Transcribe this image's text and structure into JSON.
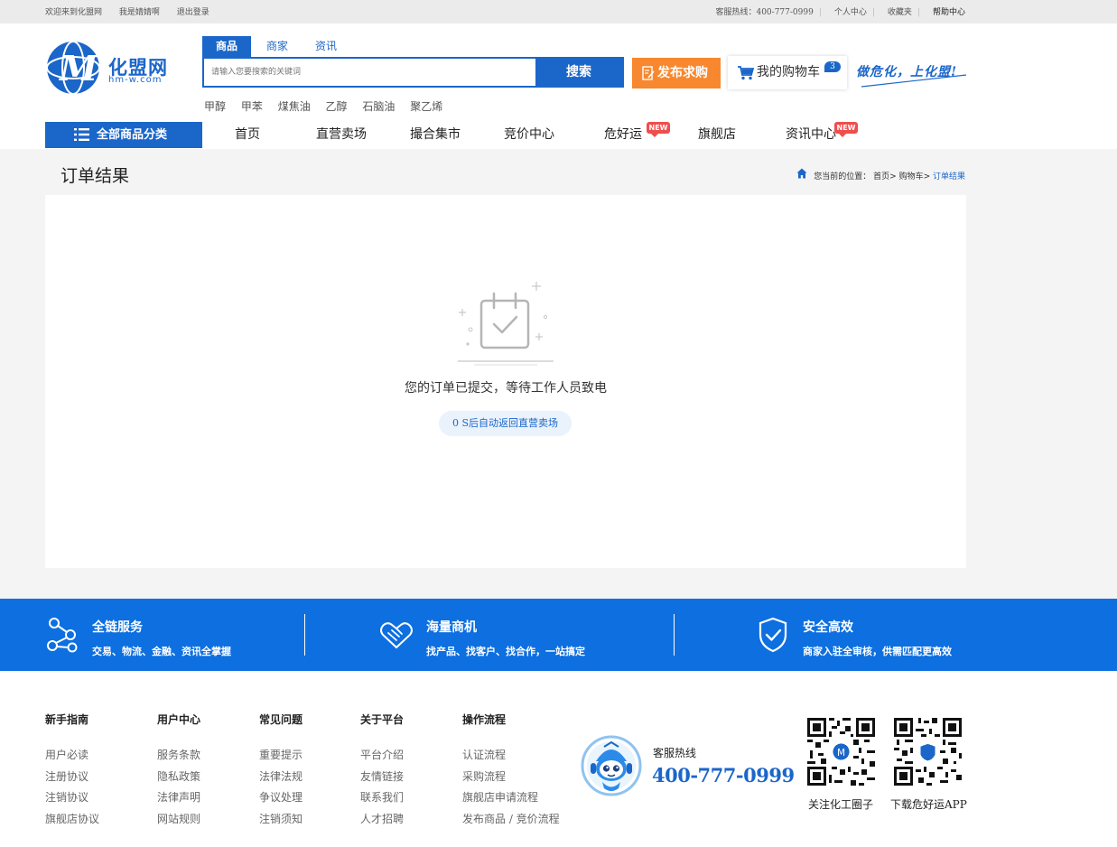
{
  "topbar": {
    "welcome": "欢迎来到化盟网",
    "username": "我是婧婧啊",
    "logout": "退出登录",
    "hotline_label": "客服热线：400-777-0999",
    "user_center": "个人中心",
    "favorites": "收藏夹",
    "help_center": "帮助中心"
  },
  "logo": {
    "name": "化盟网",
    "domain": "hm-w.com"
  },
  "search": {
    "tabs": [
      "商品",
      "商家",
      "资讯"
    ],
    "placeholder": "请输入您要搜索的关键词",
    "button": "搜索",
    "hotwords": [
      "甲醇",
      "甲苯",
      "煤焦油",
      "乙醇",
      "石脑油",
      "聚乙烯"
    ]
  },
  "header": {
    "publish_label": "发布求购",
    "cart_label": "我的购物车",
    "cart_count": "3",
    "slogan": "做危化，上化盟!"
  },
  "nav": {
    "all_categories": "全部商品分类",
    "items": [
      "首页",
      "直营卖场",
      "撮合集市",
      "竞价中心",
      "危好运",
      "旗舰店",
      "资讯中心"
    ],
    "new_badge": "NEW"
  },
  "page": {
    "title": "订单结果",
    "breadcrumb_prefix": "您当前的位置：",
    "crumb_home": "首页",
    "crumb_cart": "购物车",
    "crumb_current": "订单结果",
    "message": "您的订单已提交，等待工作人员致电",
    "return_link": "0 S后自动返回直营卖场"
  },
  "features": [
    {
      "title": "全链服务",
      "desc": "交易、物流、金融、资讯全掌握",
      "icon": "chain-service-icon"
    },
    {
      "title": "海量商机",
      "desc": "找产品、找客户、找合作，一站搞定",
      "icon": "handshake-icon"
    },
    {
      "title": "安全高效",
      "desc": "商家入驻全审核，供需匹配更高效",
      "icon": "shield-check-icon"
    }
  ],
  "footer": {
    "columns": [
      {
        "title": "新手指南",
        "links": [
          "用户必读",
          "注册协议",
          "注销协议",
          "旗舰店协议"
        ]
      },
      {
        "title": "用户中心",
        "links": [
          "服务条款",
          "隐私政策",
          "法律声明",
          "网站规则"
        ]
      },
      {
        "title": "常见问题",
        "links": [
          "重要提示",
          "法律法规",
          "争议处理",
          "注销须知"
        ]
      },
      {
        "title": "关于平台",
        "links": [
          "平台介绍",
          "友情链接",
          "联系我们",
          "人才招聘"
        ]
      },
      {
        "title": "操作流程",
        "links": [
          "认证流程",
          "采购流程",
          "旗舰店申请流程",
          "发布商品 / 竞价流程"
        ]
      }
    ],
    "hotline_label": "客服热线",
    "hotline_number": "400-777-0999",
    "qr_codes": [
      "关注化工圈子",
      "下载危好运APP"
    ]
  },
  "colors": {
    "brand_blue": "#1b66c9",
    "feature_blue": "#0d6fe0",
    "publish_orange": "#f7882f",
    "new_badge_red": "#ef4e4e"
  }
}
